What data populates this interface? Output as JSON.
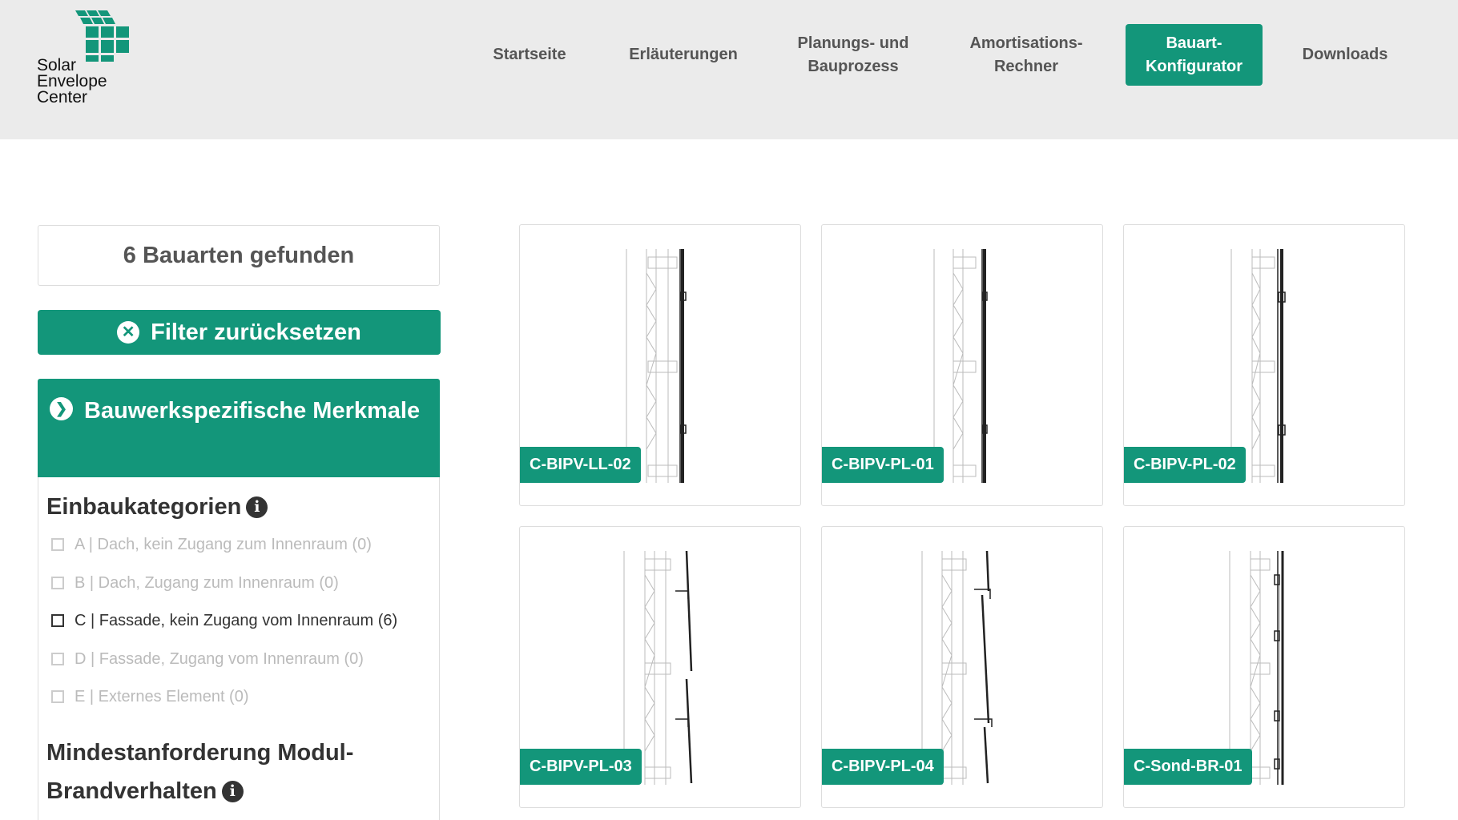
{
  "brand": {
    "logo_lines": [
      "Solar",
      "Envelope",
      "Center"
    ],
    "color": "#13967a"
  },
  "nav": [
    {
      "label": "Startseite",
      "active": false
    },
    {
      "label": "Erläuterungen",
      "active": false
    },
    {
      "label": "Planungs- und Bauprozess",
      "active": false
    },
    {
      "label": "Amortisations- Rechner",
      "active": false
    },
    {
      "label": "Bauart- Konfigurator",
      "active": true
    },
    {
      "label": "Downloads",
      "active": false
    }
  ],
  "sidebar": {
    "results_count": "6 Bauarten gefunden",
    "reset_label": "Filter zurücksetzen",
    "accordion_title": "Bauwerkspezifische Merkmale",
    "category_heading": "Einbaukategorien",
    "category_options": [
      {
        "label": "A | Dach, kein Zugang zum Innenraum (0)",
        "enabled": false
      },
      {
        "label": "B | Dach, Zugang zum Innenraum (0)",
        "enabled": false
      },
      {
        "label": "C | Fassade, kein Zugang vom Innenraum (6)",
        "enabled": true
      },
      {
        "label": "D | Fassade, Zugang vom Innenraum (0)",
        "enabled": false
      },
      {
        "label": "E | Externes Element (0)",
        "enabled": false
      }
    ],
    "fire_heading": "Mindestanforderung Modul- Brandverhalten"
  },
  "cards": [
    {
      "code": "C-BIPV-LL-02",
      "icon": "facade-section-drawing"
    },
    {
      "code": "C-BIPV-PL-01",
      "icon": "facade-section-drawing"
    },
    {
      "code": "C-BIPV-PL-02",
      "icon": "facade-section-drawing"
    },
    {
      "code": "C-BIPV-PL-03",
      "icon": "facade-section-drawing"
    },
    {
      "code": "C-BIPV-PL-04",
      "icon": "facade-section-drawing"
    },
    {
      "code": "C-Sond-BR-01",
      "icon": "facade-section-drawing"
    }
  ]
}
